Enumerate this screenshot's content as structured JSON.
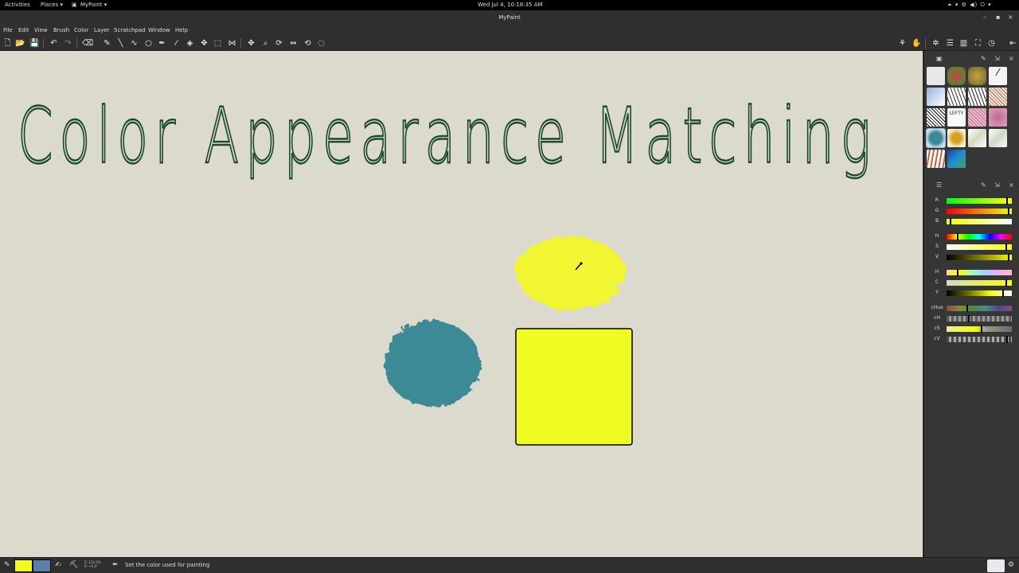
{
  "system_bar": {
    "activities": "Activities",
    "places": "Places ▾",
    "app_menu": "MyPaint ▾",
    "clock": "Wed Jul  4, 10:18:35 AM",
    "right_icons": "⏶ ▾   ⚙ ◀) ⏻ ▾"
  },
  "window": {
    "title": "MyPaint",
    "minimize": "–",
    "maximize": "▪",
    "close": "×"
  },
  "menu": {
    "items": [
      "File",
      "Edit",
      "View",
      "Brush",
      "Color",
      "Layer",
      "Scratchpad",
      "Window",
      "Help"
    ]
  },
  "toolbar": {
    "new": "🗋",
    "open": "📂",
    "save": "💾",
    "undo": "↶",
    "redo": "↷",
    "eraser": "⌫",
    "freehand": "✎",
    "line": "╲",
    "curve": "∿",
    "ellipse": "○",
    "inking": "✒",
    "fill": "◈",
    "picker": "⁄",
    "frame": "⬚",
    "crop": "⬜",
    "symmetry": "⋈",
    "pan": "✥",
    "zoom": "⌕",
    "rotate": "⟳",
    "flip": "⇔",
    "reset": "⟲",
    "rot_view": "◌",
    "r_brushmod": "⚘",
    "r_hand": "✋",
    "r_settings": "✲",
    "r_menu": "☰",
    "r_layers": "▥",
    "r_fullscreen": "⛶",
    "r_history": "◷",
    "r_collapse": "⇤"
  },
  "canvas": {
    "handwriting": "Color Appearance Matching",
    "colors": {
      "background": "#dcdacc",
      "ink": "#1b4a2d",
      "yellow_blob": "#f3f72a",
      "teal_blob": "#3a8a96",
      "square": "#eefc22"
    }
  },
  "brush_panel": {
    "labels": [
      "",
      "",
      "",
      "",
      "",
      "",
      "",
      "",
      "",
      "LEFTY",
      "",
      "",
      "",
      "",
      "",
      "",
      "",
      ""
    ]
  },
  "color_panel": {
    "rows": [
      {
        "label": "R",
        "value": 0.96
      },
      {
        "label": "G",
        "value": 0.99
      },
      {
        "label": "B",
        "value": 0.05
      },
      {
        "label": "H",
        "value": 0.17
      },
      {
        "label": "S",
        "value": 0.95
      },
      {
        "label": "V",
        "value": 0.99
      },
      {
        "label": "H",
        "value": 0.17
      },
      {
        "label": "C",
        "value": 0.95
      },
      {
        "label": "Y",
        "value": 0.9
      },
      {
        "label": "cHue",
        "value": 0.32
      },
      {
        "label": "cH",
        "value": 0.35
      },
      {
        "label": "cS",
        "value": 0.55
      },
      {
        "label": "cV",
        "value": 0.96
      }
    ]
  },
  "status": {
    "zoom": "Z: 124.3%",
    "rotation": "R: +0.0°",
    "message": "Set the color used for painting",
    "fg_color": "#eefc22",
    "bg_color": "#5b7fa6"
  }
}
